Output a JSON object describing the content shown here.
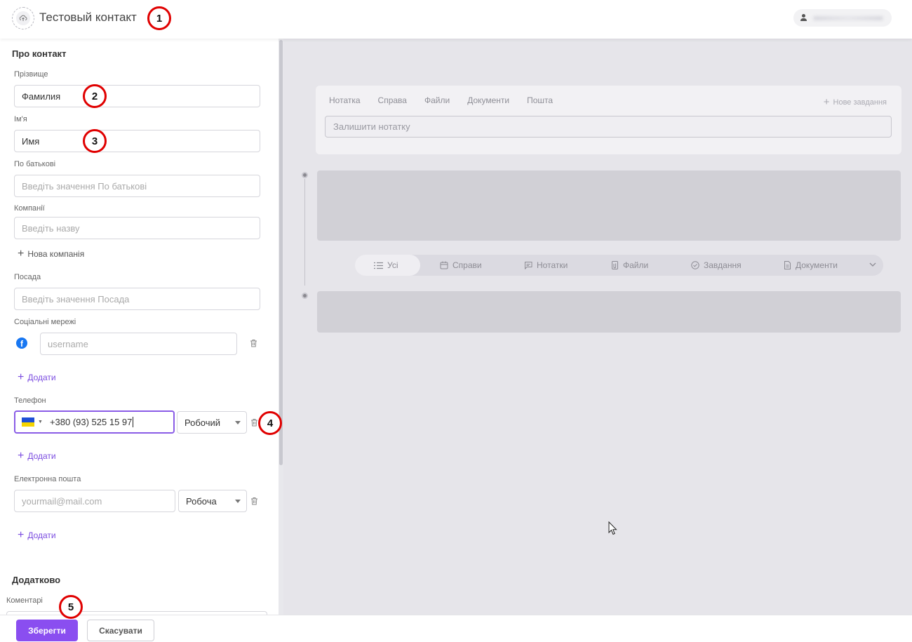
{
  "header": {
    "title": "Тестовый контакт",
    "avatar_icon": "upload-cloud-icon",
    "user_icon": "user-icon"
  },
  "markers": [
    "1",
    "2",
    "3",
    "4",
    "5"
  ],
  "form": {
    "section_about": "Про контакт",
    "last_name": {
      "label": "Прізвище",
      "value": "Фамилия"
    },
    "first_name": {
      "label": "Ім'я",
      "value": "Имя"
    },
    "patronymic": {
      "label": "По батькові",
      "placeholder": "Введіть значення По батькові"
    },
    "companies": {
      "label": "Компанії",
      "placeholder": "Введіть назву"
    },
    "new_company": "Нова компанія",
    "position": {
      "label": "Посада",
      "placeholder": "Введіть значення Посада"
    },
    "social": {
      "label": "Соціальні мережі",
      "placeholder": "username",
      "icon": "facebook-icon"
    },
    "add_label": "Додати",
    "phone": {
      "label": "Телефон",
      "value": "+380 (93) 525 15 97",
      "type": "Робочий"
    },
    "email": {
      "label": "Електронна пошта",
      "placeholder": "yourmail@mail.com",
      "type": "Робоча"
    },
    "section_extra": "Додатково",
    "comments_label": "Коментарі"
  },
  "actions": {
    "save": "Зберегти",
    "cancel": "Скасувати"
  },
  "activity": {
    "tabs": [
      "Нотатка",
      "Справа",
      "Файли",
      "Документи",
      "Пошта"
    ],
    "new_task": "Нове завдання",
    "note_placeholder": "Залишити нотатку",
    "filters": [
      "Усі",
      "Справи",
      "Нотатки",
      "Файли",
      "Завдання",
      "Документи"
    ]
  },
  "colors": {
    "accent": "#8a4ef0",
    "marker": "#e00000",
    "overlay": "#e6e5ea"
  }
}
